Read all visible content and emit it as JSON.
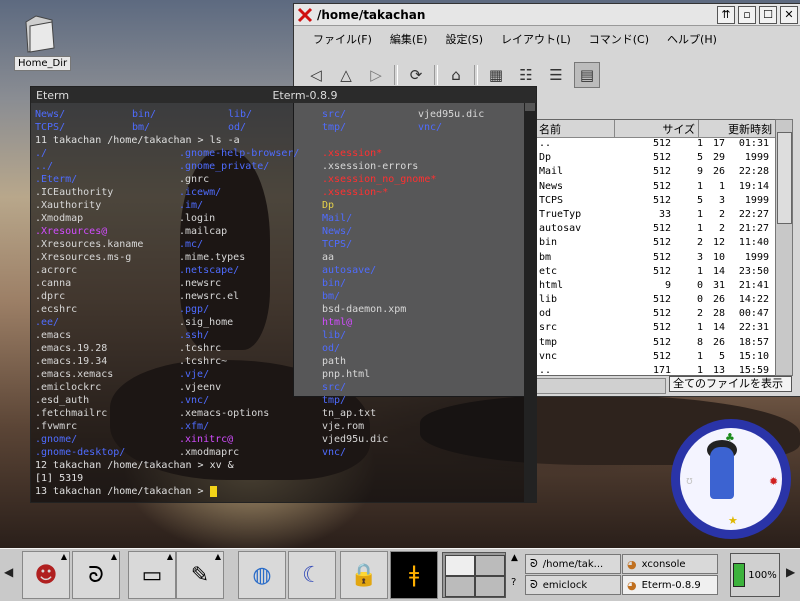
{
  "desktop": {
    "icons": [
      {
        "label": "Home_Dir",
        "icon": "folder-icon"
      }
    ]
  },
  "file_manager": {
    "title": "/home/takachan",
    "title_buttons": [
      "⇈",
      "▫",
      "☐",
      "✕"
    ],
    "menu": [
      "ファイル(F)",
      "編集(E)",
      "設定(S)",
      "レイアウト(L)",
      "コマンド(C)",
      "ヘルプ(H)"
    ],
    "toolbar": [
      "back-icon",
      "up-icon",
      "forward-icon",
      "refresh-icon",
      "home-icon",
      "view-icons-icon",
      "view-list-icon",
      "view-details-icon",
      "view-custom-icon"
    ],
    "columns": [
      "名前",
      "サイズ",
      "更新時刻"
    ],
    "files": [
      {
        "name": "..",
        "size": "512",
        "mon": "1",
        "day": "17",
        "time": "01:31"
      },
      {
        "name": "Dp",
        "size": "512",
        "mon": "5",
        "day": "29",
        "time": "1999"
      },
      {
        "name": "Mail",
        "size": "512",
        "mon": "9",
        "day": "26",
        "time": "22:28"
      },
      {
        "name": "News",
        "size": "512",
        "mon": "1",
        "day": "1",
        "time": "19:14"
      },
      {
        "name": "TCPS",
        "size": "512",
        "mon": "5",
        "day": "3",
        "time": "1999"
      },
      {
        "name": "TrueTyp",
        "size": "33",
        "mon": "1",
        "day": "2",
        "time": "22:27"
      },
      {
        "name": "autosav",
        "size": "512",
        "mon": "1",
        "day": "2",
        "time": "21:27"
      },
      {
        "name": "bin",
        "size": "512",
        "mon": "2",
        "day": "12",
        "time": "11:40"
      },
      {
        "name": "bm",
        "size": "512",
        "mon": "3",
        "day": "10",
        "time": "1999"
      },
      {
        "name": "etc",
        "size": "512",
        "mon": "1",
        "day": "14",
        "time": "23:50"
      },
      {
        "name": "html",
        "size": "9",
        "mon": "0",
        "day": "31",
        "time": "21:41"
      },
      {
        "name": "lib",
        "size": "512",
        "mon": "0",
        "day": "26",
        "time": "14:22"
      },
      {
        "name": "od",
        "size": "512",
        "mon": "2",
        "day": "28",
        "time": "00:47"
      },
      {
        "name": "src",
        "size": "512",
        "mon": "1",
        "day": "14",
        "time": "22:31"
      },
      {
        "name": "tmp",
        "size": "512",
        "mon": "8",
        "day": "26",
        "time": "18:57"
      },
      {
        "name": "vnc",
        "size": "512",
        "mon": "1",
        "day": "5",
        "time": "15:10"
      },
      {
        "name": "..",
        "size": "171",
        "mon": "1",
        "day": "13",
        "time": "15:59"
      }
    ],
    "filter": "全てのファイルを表示"
  },
  "eterm": {
    "tab": "Eterm",
    "title": "Eterm-0.8.9",
    "top_lines": [
      [
        "News/",
        "bin/",
        "lib/",
        "src/",
        "vjed95u.dic"
      ],
      [
        "TCPS/",
        "bm/",
        "od/",
        "tmp/",
        "vnc/"
      ]
    ],
    "prompt1": "11 takachan /home/takachan > ls -a",
    "listing": [
      [
        [
          "./",
          "dir"
        ],
        [
          ".gnome-help-browser/",
          "dir"
        ],
        [
          ".xsession*",
          "red"
        ]
      ],
      [
        [
          "../",
          "dir"
        ],
        [
          ".gnome_private/",
          "dir"
        ],
        [
          ".xsession-errors",
          "fil"
        ]
      ],
      [
        [
          ".Eterm/",
          "dir"
        ],
        [
          ".gnrc",
          "fil"
        ],
        [
          ".xsession_no_gnome*",
          "red"
        ]
      ],
      [
        [
          ".ICEauthority",
          "fil"
        ],
        [
          ".icewm/",
          "dir"
        ],
        [
          ".xsession~*",
          "red"
        ]
      ],
      [
        [
          ".Xauthority",
          "fil"
        ],
        [
          ".im/",
          "dir"
        ],
        [
          "Dp",
          "yel"
        ]
      ],
      [
        [
          ".Xmodmap",
          "fil"
        ],
        [
          ".login",
          "fil"
        ],
        [
          "Mail/",
          "dir"
        ]
      ],
      [
        [
          ".Xresources@",
          "lnk"
        ],
        [
          ".mailcap",
          "fil"
        ],
        [
          "News/",
          "dir"
        ]
      ],
      [
        [
          ".Xresources.kaname",
          "fil"
        ],
        [
          ".mc/",
          "dir"
        ],
        [
          "TCPS/",
          "dir"
        ]
      ],
      [
        [
          ".Xresources.ms-g",
          "fil"
        ],
        [
          ".mime.types",
          "fil"
        ],
        [
          "aa",
          "fil"
        ]
      ],
      [
        [
          ".acrorc",
          "fil"
        ],
        [
          ".netscape/",
          "dir"
        ],
        [
          "autosave/",
          "dir"
        ]
      ],
      [
        [
          ".canna",
          "fil"
        ],
        [
          ".newsrc",
          "fil"
        ],
        [
          "bin/",
          "dir"
        ]
      ],
      [
        [
          ".dprc",
          "fil"
        ],
        [
          ".newsrc.el",
          "fil"
        ],
        [
          "bm/",
          "dir"
        ]
      ],
      [
        [
          ".ecshrc",
          "fil"
        ],
        [
          ".pgp/",
          "dir"
        ],
        [
          "bsd-daemon.xpm",
          "fil"
        ]
      ],
      [
        [
          ".ee/",
          "dir"
        ],
        [
          ".sig_home",
          "fil"
        ],
        [
          "html@",
          "lnk"
        ]
      ],
      [
        [
          ".emacs",
          "fil"
        ],
        [
          ".ssh/",
          "dir"
        ],
        [
          "lib/",
          "dir"
        ]
      ],
      [
        [
          ".emacs.19.28",
          "fil"
        ],
        [
          ".tcshrc",
          "fil"
        ],
        [
          "od/",
          "dir"
        ]
      ],
      [
        [
          ".emacs.19.34",
          "fil"
        ],
        [
          ".tcshrc~",
          "fil"
        ],
        [
          "path",
          "fil"
        ]
      ],
      [
        [
          ".emacs.xemacs",
          "fil"
        ],
        [
          ".vje/",
          "dir"
        ],
        [
          "pnp.html",
          "fil"
        ]
      ],
      [
        [
          ".emiclockrc",
          "fil"
        ],
        [
          ".vjeenv",
          "fil"
        ],
        [
          "src/",
          "dir"
        ]
      ],
      [
        [
          ".esd_auth",
          "fil"
        ],
        [
          ".vnc/",
          "dir"
        ],
        [
          "tmp/",
          "dir"
        ]
      ],
      [
        [
          ".fetchmailrc",
          "fil"
        ],
        [
          ".xemacs-options",
          "fil"
        ],
        [
          "tn_ap.txt",
          "fil"
        ]
      ],
      [
        [
          ".fvwmrc",
          "fil"
        ],
        [
          ".xfm/",
          "dir"
        ],
        [
          "vje.rom",
          "fil"
        ]
      ],
      [
        [
          ".gnome/",
          "dir"
        ],
        [
          ".xinitrc@",
          "lnk"
        ],
        [
          "vjed95u.dic",
          "fil"
        ]
      ],
      [
        [
          ".gnome-desktop/",
          "dir"
        ],
        [
          ".xmodmaprc",
          "fil"
        ],
        [
          "vnc/",
          "dir"
        ]
      ]
    ],
    "prompt2": "12 takachan /home/takachan > xv &",
    "job": "[1] 5319",
    "prompt3": "13 takachan /home/takachan > "
  },
  "taskbar": {
    "tasks": [
      {
        "label": "/home/tak...",
        "icon": "terminal-icon",
        "active": false
      },
      {
        "label": "xconsole",
        "icon": "xconsole-icon",
        "active": false
      },
      {
        "label": "emiclock",
        "icon": "clock-icon",
        "active": false
      },
      {
        "label": "Eterm-0.8.9",
        "icon": "terminal-icon",
        "active": true
      }
    ],
    "battery": "100%"
  },
  "colors": {
    "dir": "#4f6cff",
    "link": "#d24cff",
    "exec": "#ff3030",
    "cursor": "#f2d318"
  }
}
